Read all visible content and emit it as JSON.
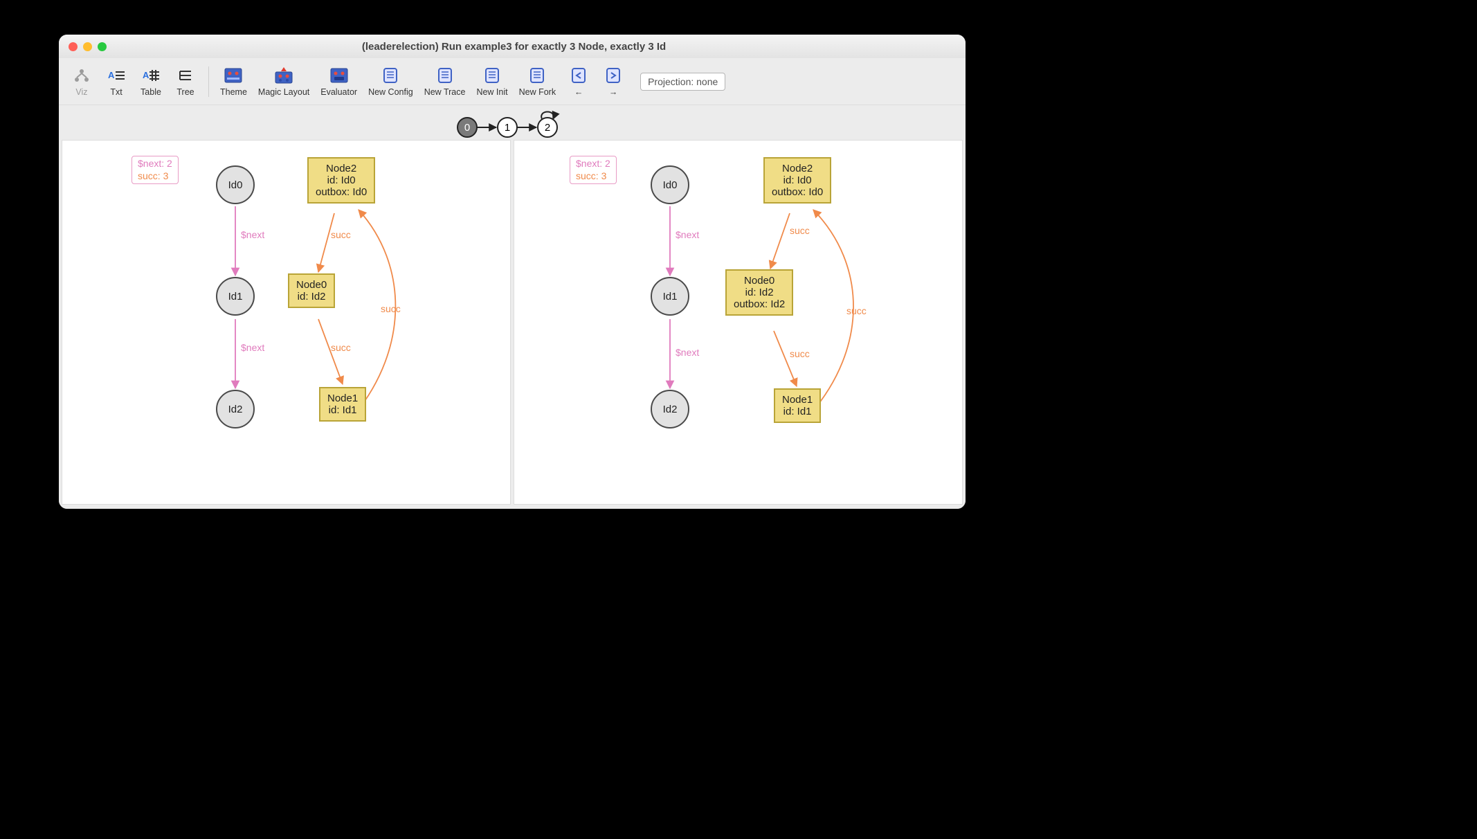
{
  "window_title": "(leaderelection) Run example3 for exactly 3 Node, exactly 3 Id",
  "toolbar": {
    "viz": "Viz",
    "txt": "Txt",
    "table": "Table",
    "tree": "Tree",
    "theme": "Theme",
    "magic": "Magic Layout",
    "eval": "Evaluator",
    "newconfig": "New Config",
    "newtrace": "New Trace",
    "newinit": "New Init",
    "newfork": "New Fork",
    "prev": "←",
    "next": "→",
    "projection": "Projection: none"
  },
  "trace": {
    "states": [
      "0",
      "1",
      "2"
    ],
    "current": 0,
    "loop_on": 2
  },
  "panes": {
    "left": {
      "badge1": "$next: 2",
      "badge2": "succ: 3",
      "id0": "Id0",
      "id1": "Id1",
      "id2": "Id2",
      "next_lbl": "$next",
      "succ_lbl": "succ",
      "node2_l1": "Node2",
      "node2_l2": "id: Id0",
      "node2_l3": "outbox: Id0",
      "node0_l1": "Node0",
      "node0_l2": "id: Id2",
      "node1_l1": "Node1",
      "node1_l2": "id: Id1"
    },
    "right": {
      "badge1": "$next: 2",
      "badge2": "succ: 3",
      "id0": "Id0",
      "id1": "Id1",
      "id2": "Id2",
      "next_lbl": "$next",
      "succ_lbl": "succ",
      "node2_l1": "Node2",
      "node2_l2": "id: Id0",
      "node2_l3": "outbox: Id0",
      "node0_l1": "Node0",
      "node0_l2": "id: Id2",
      "node0_l3": "outbox: Id2",
      "node1_l1": "Node1",
      "node1_l2": "id: Id1"
    }
  }
}
